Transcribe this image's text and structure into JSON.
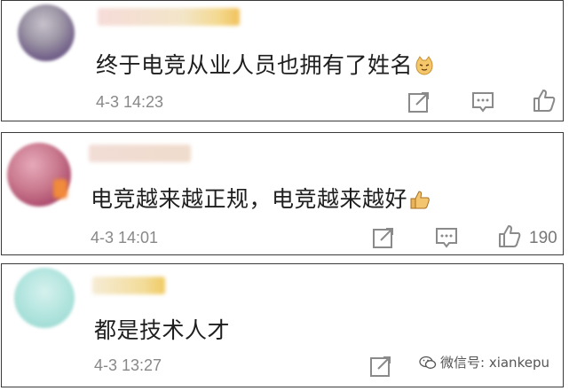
{
  "comments": [
    {
      "text": "终于电竞从业人员也拥有了姓名",
      "time": "4-3 14:23",
      "emoji": "cat-face-emoji",
      "likes": ""
    },
    {
      "text": "电竞越来越正规，电竞越来越好",
      "time": "4-3 14:01",
      "emoji": "thumbs-up-emoji",
      "likes": "190"
    },
    {
      "text": "都是技术人才",
      "time": "4-3 13:27",
      "emoji": "",
      "likes": ""
    }
  ],
  "icons": {
    "share": "share-icon",
    "reply": "comment-icon",
    "like": "like-icon"
  },
  "watermark": {
    "text": "微信号: xiankepu"
  },
  "colors": {
    "border": "#3a3a3a",
    "text": "#1e1e1e",
    "muted": "#888888"
  }
}
